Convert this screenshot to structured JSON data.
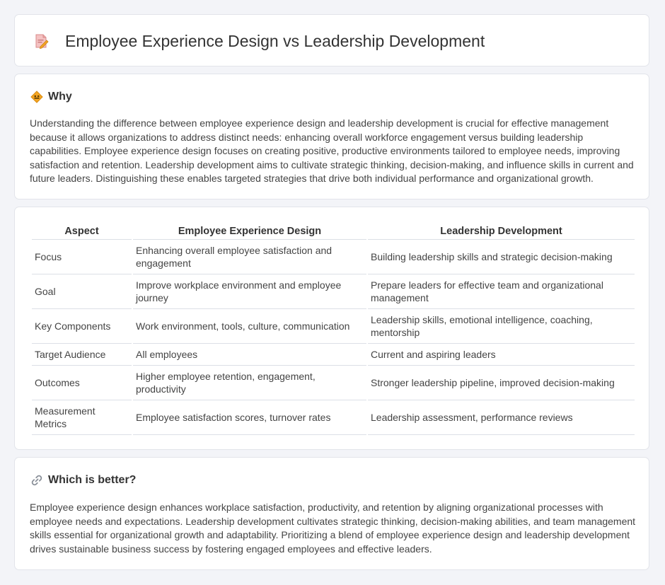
{
  "header": {
    "title": "Employee Experience Design vs Leadership Development",
    "icon": "document-pencil-icon"
  },
  "why": {
    "heading": "Why",
    "icon": "diamond-sign-icon",
    "text": "Understanding the difference between employee experience design and leadership development is crucial for effective management because it allows organizations to address distinct needs: enhancing overall workforce engagement versus building leadership capabilities. Employee experience design focuses on creating positive, productive environments tailored to employee needs, improving satisfaction and retention. Leadership development aims to cultivate strategic thinking, decision-making, and influence skills in current and future leaders. Distinguishing these enables targeted strategies that drive both individual performance and organizational growth."
  },
  "table": {
    "headers": [
      "Aspect",
      "Employee Experience Design",
      "Leadership Development"
    ],
    "rows": [
      [
        "Focus",
        "Enhancing overall employee satisfaction and engagement",
        "Building leadership skills and strategic decision-making"
      ],
      [
        "Goal",
        "Improve workplace environment and employee journey",
        "Prepare leaders for effective team and organizational management"
      ],
      [
        "Key Components",
        "Work environment, tools, culture, communication",
        "Leadership skills, emotional intelligence, coaching, mentorship"
      ],
      [
        "Target Audience",
        "All employees",
        "Current and aspiring leaders"
      ],
      [
        "Outcomes",
        "Higher employee retention, engagement, productivity",
        "Stronger leadership pipeline, improved decision-making"
      ],
      [
        "Measurement Metrics",
        "Employee satisfaction scores, turnover rates",
        "Leadership assessment, performance reviews"
      ]
    ]
  },
  "better": {
    "heading": "Which is better?",
    "icon": "link-icon",
    "text": "Employee experience design enhances workplace satisfaction, productivity, and retention by aligning organizational processes with employee needs and expectations. Leadership development cultivates strategic thinking, decision-making abilities, and team management skills essential for organizational growth and adaptability. Prioritizing a blend of employee experience design and leadership development drives sustainable business success by fostering engaged employees and effective leaders."
  },
  "colors": {
    "page_bg": "#f3f4f8",
    "card_bg": "#ffffff",
    "text": "#333333",
    "icon_orange": "#f5a623",
    "icon_pink": "#f3b8b8"
  }
}
